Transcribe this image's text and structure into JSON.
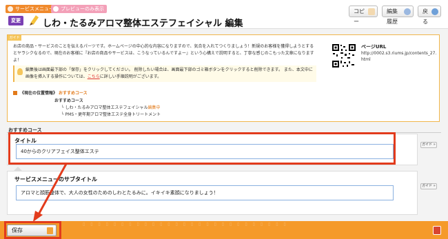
{
  "header": {
    "breadcrumb_service": "サービスメニュー",
    "breadcrumb_preview": "プレビューのみ表示",
    "change_badge": "変更",
    "page_title": "しわ・たるみアロマ整体エステフェイシャル 編集",
    "copy_label": "コピー",
    "history_label": "編集履歴",
    "back_label": "戻る"
  },
  "info": {
    "tab": "ガイド",
    "description": "お店の商品・サービスのことを伝えるパーツです。ホームページの中心的な内容になりますので、気合を入れてつくりましょう！新規のお客様を獲得しようとするとヤラシクなるので、現在のお客様に『お店の商品やサービスは、こうなっているんですよー』という心構えで説明すると、丁寧な感じのこもった文章になりますよ！",
    "notice_text": "編集後は画面最下部の「保存」をクリックしてください。 削除したい場合は、画面最下部のゴミ箱ボタンをクリックすると削除できます。 また、本文中に画像を挿入する操作については、",
    "notice_link": "こちら",
    "notice_tail": "に詳しい手順説明がございます。",
    "page_url_label": "ページURL",
    "page_url": "http://0002.s3.riums.jp/contents_27.html",
    "location_label": "《現在の位置情報》",
    "location_current": "おすすめコース",
    "location_parent": "おすすめコース",
    "location_item1": "しわ・たるみアロマ整体エステフェイシャル",
    "location_item1_edit": "編集中",
    "location_item2": "PMS・更年期アロマ整体エステ全身トリートメント"
  },
  "section": {
    "label": "おすすめコース"
  },
  "title_field": {
    "label": "タイトル",
    "value": "40からのクリアフェイス整体エステ",
    "guide": "ガイド »"
  },
  "subtitle_field": {
    "label": "サービスメニューのサブタイトル",
    "value": "アロマと顔筋整体で、大人の女性のためのしわとたるみに。イキイキ素顔になりましょう！",
    "guide": "ガイド »"
  },
  "footer": {
    "save_label": "保存"
  },
  "colors": {
    "accent": "#f59a2a",
    "highlight": "#e23b1c",
    "badge": "#7a3fb3"
  }
}
